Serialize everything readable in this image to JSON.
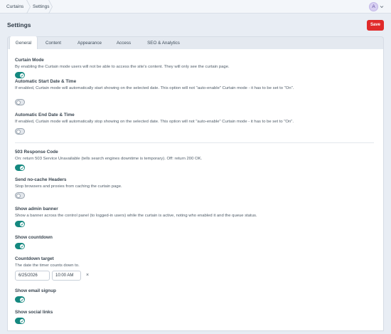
{
  "breadcrumb": [
    "Curtains",
    "Settings"
  ],
  "user": {
    "avatar_initial": "A"
  },
  "page": {
    "title": "Settings",
    "save_label": "Save"
  },
  "tabs": [
    {
      "label": "General",
      "active": true
    },
    {
      "label": "Content",
      "active": false
    },
    {
      "label": "Appearance",
      "active": false
    },
    {
      "label": "Access",
      "active": false
    },
    {
      "label": "SEO & Analytics",
      "active": false
    }
  ],
  "fields": {
    "curtain_mode": {
      "label": "Curtain Mode",
      "desc": "By enabling the Curtain mode users will not be able to access the site's content. They will only see the curtain page.",
      "on": true
    },
    "auto_start": {
      "label": "Automatic Start Date & Time",
      "desc": "If enabled, Curtain mode will automatically start showing on the selected date. This option will not \"auto-enable\" Curtain mode - it has to be set to \"On\".",
      "on": false
    },
    "auto_end": {
      "label": "Automatic End Date & Time",
      "desc": "If enabled, Curtain mode will automatically stop showing on the selected date. This option will not \"auto-enable\" Curtain mode - it has to be set to \"On\".",
      "on": false
    },
    "response_503": {
      "label": "503 Response Code",
      "desc": "On: return 503 Service Unavailable (tells search engines downtime is temporary). Off: return 200 OK.",
      "on": true
    },
    "no_cache": {
      "label": "Send no-cache Headers",
      "desc": "Stop browsers and proxies from caching the curtain page.",
      "on": false
    },
    "admin_banner": {
      "label": "Show admin banner",
      "desc": "Show a banner across the control panel (to logged-in users) while the curtain is active, noting who enabled it and the queue status.",
      "on": true
    },
    "countdown": {
      "label": "Show countdown",
      "on": true
    },
    "countdown_target": {
      "label": "Countdown target",
      "desc": "The date the timer counts down to.",
      "date": "6/25/2026",
      "time": "10:00 AM",
      "clear": "×"
    },
    "email_signup": {
      "label": "Show email signup",
      "on": true
    },
    "social_links": {
      "label": "Show social links",
      "on": true
    }
  },
  "colors": {
    "accent": "#14887f",
    "danger": "#e02a2a"
  }
}
